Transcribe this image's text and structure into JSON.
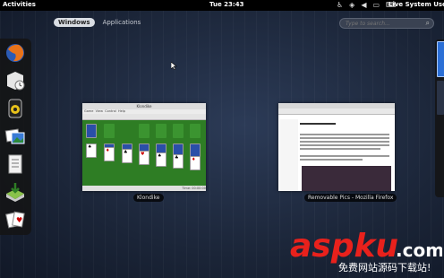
{
  "topbar": {
    "activities": "Activities",
    "clock": "Tue 23:43",
    "user": "Live System User",
    "tray_icons": [
      "accessibility-icon",
      "network-icon",
      "volume-icon",
      "battery-icon",
      "keyboard-icon"
    ]
  },
  "view_selector": {
    "windows": "Windows",
    "applications": "Applications"
  },
  "search": {
    "placeholder": "Type to search..."
  },
  "dash": {
    "apps": [
      "firefox-icon",
      "evolution-icon",
      "rhythmbox-icon",
      "shotwell-icon",
      "document-viewer-icon",
      "software-install-icon",
      "solitaire-icon"
    ]
  },
  "windows": [
    {
      "label": "Klondike",
      "app": "solitaire",
      "title": "Klondike",
      "status": "Time: 00:00:00"
    },
    {
      "label": "Removable Pics - Mozilla Firefox",
      "app": "firefox"
    }
  ],
  "watermark": {
    "brand": "aspku",
    "suffix": ".com",
    "tagline": "免费网站源码下载站!"
  },
  "colors": {
    "background": "#1b2538",
    "felt": "#2e7d24",
    "accent": "#2b6fd6",
    "watermark": "#e8211c"
  }
}
